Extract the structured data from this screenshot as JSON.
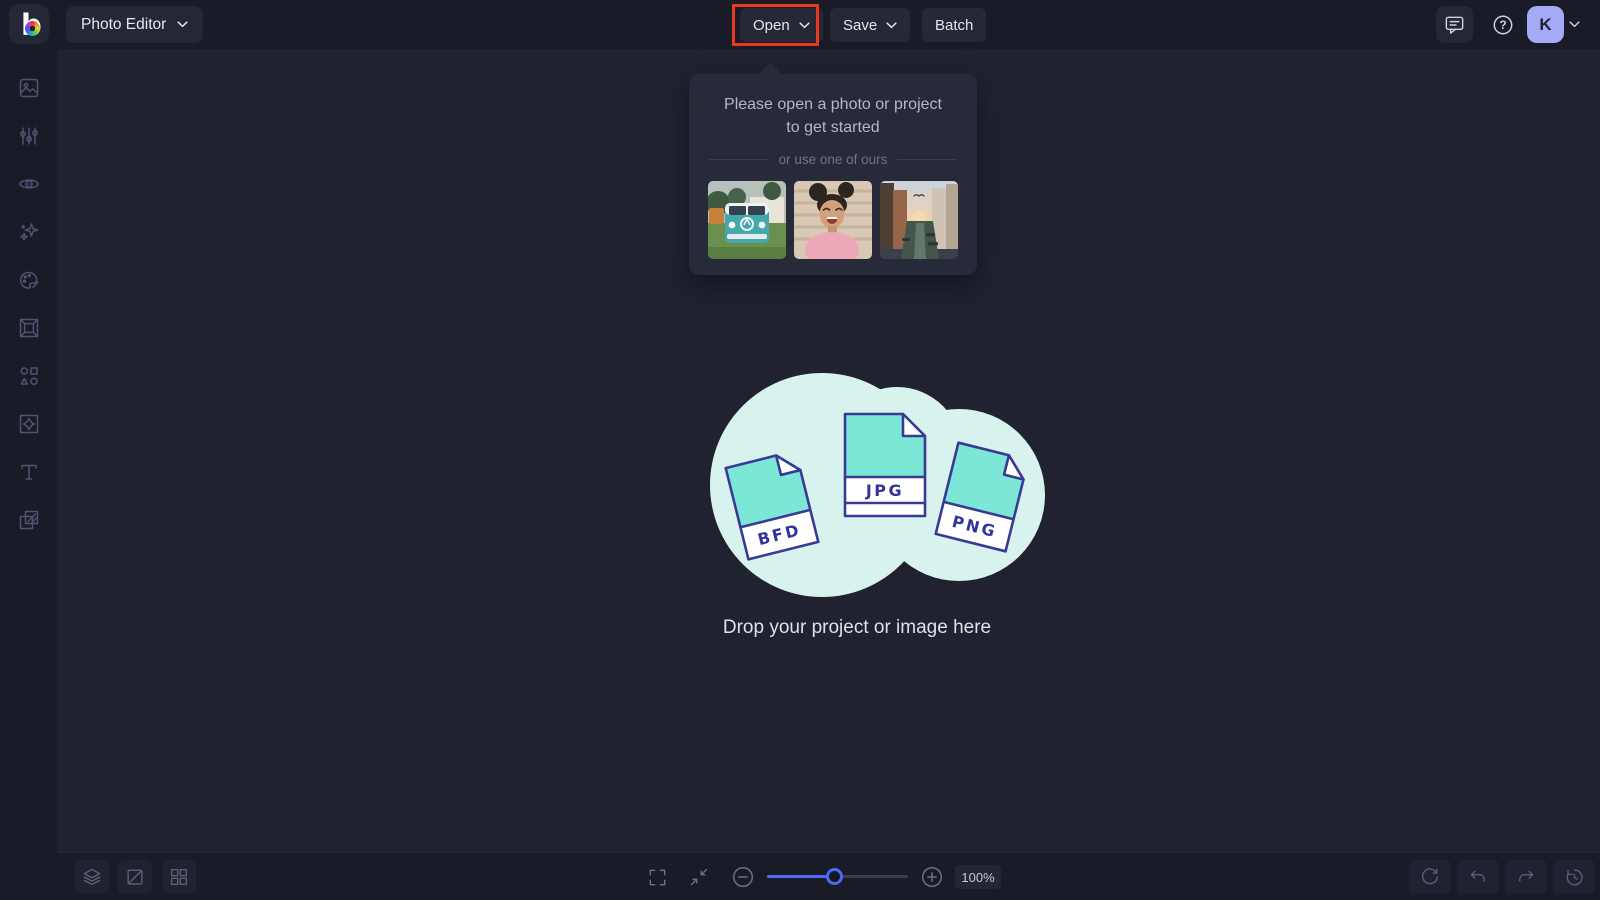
{
  "topbar": {
    "logo_letter": "b",
    "workspace": {
      "label": "Photo Editor"
    },
    "open_label": "Open",
    "save_label": "Save",
    "batch_label": "Batch",
    "help_glyph": "?",
    "user_initial": "K"
  },
  "sidebar": {
    "icons": [
      "photo-icon",
      "adjustments-icon",
      "eye-icon",
      "sparkles-icon",
      "palette-icon",
      "frame-icon",
      "shapes-icon",
      "overlay-icon",
      "text-icon",
      "textures-icon"
    ]
  },
  "popover": {
    "title": "Please open a photo or project to get started",
    "divider_label": "or use one of ours",
    "samples": [
      "camper-van-sample",
      "portrait-sample",
      "canal-sample"
    ]
  },
  "canvas": {
    "file_types": [
      "BFD",
      "JPG",
      "PNG"
    ],
    "drop_hint": "Drop your project or image here"
  },
  "bottombar": {
    "zoom_value": "100%"
  },
  "annotation": {
    "highlight_color": "#e8391f"
  },
  "colors": {
    "topbar_bg": "#191b27",
    "canvas_bg": "#20222f",
    "panel_bg": "#272b39",
    "button_bg": "#252836",
    "accent_blue": "#4a6af5",
    "avatar_bg": "#a5aaf7",
    "file_teal": "#7ce6d7",
    "file_outline": "#383a95",
    "blob_mint": "#d8f3ee"
  }
}
